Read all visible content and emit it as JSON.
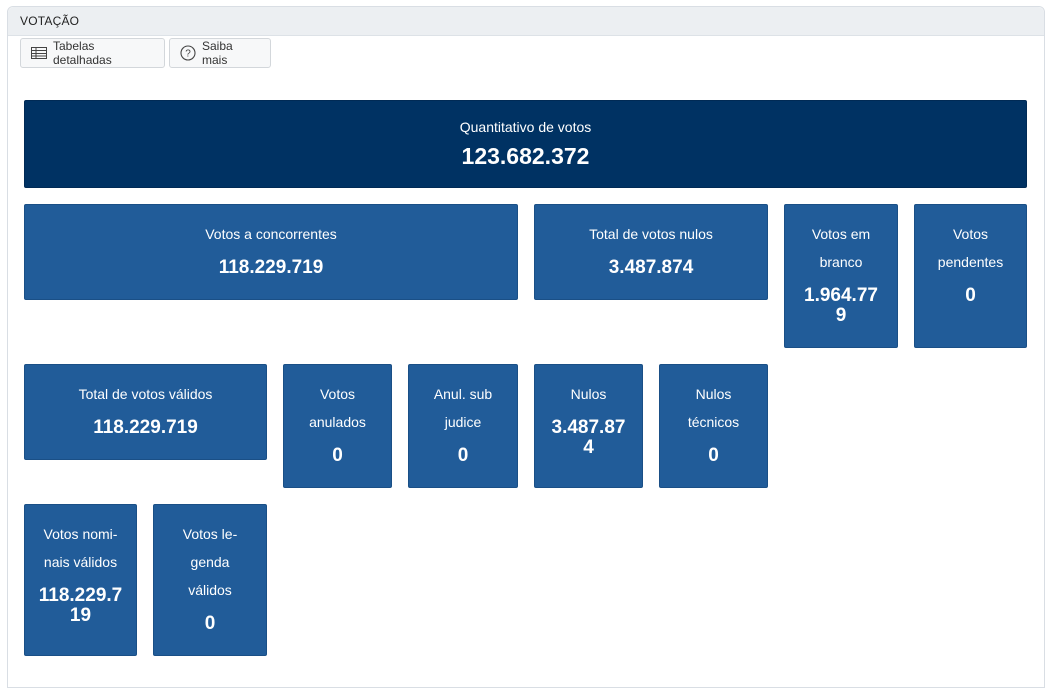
{
  "panel": {
    "title": "VOTAÇÃO"
  },
  "toolbar": {
    "tables_label": "Tabelas detalhadas",
    "tables_icon": "table-icon",
    "help_label": "Saiba mais",
    "help_icon": "question-circle-icon"
  },
  "colors": {
    "hero": "#003263",
    "card": "#215c99"
  },
  "cards": {
    "total": {
      "label": "Quantitativo de votos",
      "value": "123.682.372"
    },
    "concorrentes": {
      "label": "Votos a concorrentes",
      "value": "118.229.719"
    },
    "nulos_total": {
      "label": "Total de votos nulos",
      "value": "3.487.874"
    },
    "branco": {
      "label_1": "Votos em",
      "label_2": "branco",
      "value_1": "1.964.77",
      "value_2": "9"
    },
    "pendentes": {
      "label_1": "Votos",
      "label_2": "pendentes",
      "value": "0"
    },
    "validos": {
      "label": "Total de votos válidos",
      "value": "118.229.719"
    },
    "anulados": {
      "label_1": "Votos",
      "label_2": "anulados",
      "value": "0"
    },
    "sub_judice": {
      "label_1": "Anul. sub",
      "label_2": "judice",
      "value": "0"
    },
    "nulos": {
      "label": "Nulos",
      "value_1": "3.487.87",
      "value_2": "4"
    },
    "nulos_tecnicos": {
      "label_1": "Nulos",
      "label_2": "técnicos",
      "value": "0"
    },
    "nominais": {
      "label_1": "Votos nomi-",
      "label_2": "nais válidos",
      "value_1": "118.229.7",
      "value_2": "19"
    },
    "legenda": {
      "label_1": "Votos le-",
      "label_2": "genda",
      "label_3": "válidos",
      "value": "0"
    }
  }
}
